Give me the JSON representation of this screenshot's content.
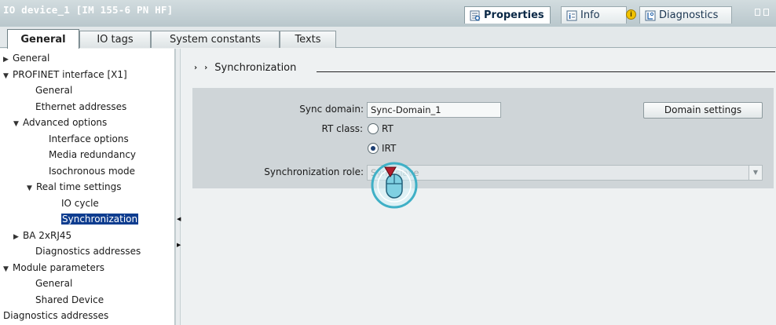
{
  "window": {
    "title": "IO device_1 [IM 155-6 PN HF]",
    "tabs": [
      {
        "label": "Properties",
        "icon": "properties-icon",
        "active": true
      },
      {
        "label": "Info",
        "icon": "info-icon",
        "active": false
      },
      {
        "label": "Diagnostics",
        "icon": "diagnostics-icon",
        "active": false
      }
    ]
  },
  "subtabs": [
    {
      "label": "General",
      "active": true
    },
    {
      "label": "IO tags",
      "active": false
    },
    {
      "label": "System constants",
      "active": false
    },
    {
      "label": "Texts",
      "active": false
    }
  ],
  "tree": [
    {
      "label": "General",
      "level": 0,
      "arrow": "right"
    },
    {
      "label": "PROFINET interface [X1]",
      "level": 0,
      "arrow": "down"
    },
    {
      "label": "General",
      "level": 2,
      "arrow": ""
    },
    {
      "label": "Ethernet addresses",
      "level": 2,
      "arrow": ""
    },
    {
      "label": "Advanced options",
      "level": 1,
      "arrow": "down"
    },
    {
      "label": "Interface options",
      "level": 3,
      "arrow": ""
    },
    {
      "label": "Media redundancy",
      "level": 3,
      "arrow": ""
    },
    {
      "label": "Isochronous mode",
      "level": 3,
      "arrow": ""
    },
    {
      "label": "Real time settings",
      "level": 2,
      "arrow": "down"
    },
    {
      "label": "IO cycle",
      "level": 4,
      "arrow": ""
    },
    {
      "label": "Synchronization",
      "level": 4,
      "arrow": "",
      "selected": true
    },
    {
      "label": "BA 2xRJ45",
      "level": 1,
      "arrow": "right"
    },
    {
      "label": "Diagnostics addresses",
      "level": 2,
      "arrow": ""
    },
    {
      "label": "Module parameters",
      "level": 0,
      "arrow": "down"
    },
    {
      "label": "General",
      "level": 2,
      "arrow": ""
    },
    {
      "label": "Shared Device",
      "level": 2,
      "arrow": ""
    },
    {
      "label": "Diagnostics addresses",
      "level": 0,
      "arrow": ""
    }
  ],
  "section": {
    "title": "Synchronization",
    "sync_domain_label": "Sync domain:",
    "sync_domain_value": "Sync-Domain_1",
    "domain_settings_button": "Domain settings",
    "rt_class_label": "RT class:",
    "rt_option": "RT",
    "irt_option": "IRT",
    "rt_class_selected": "IRT",
    "sync_role_label": "Synchronization role:",
    "sync_role_value": "Sync slave"
  },
  "colors": {
    "selection": "#0f3d8f",
    "cursor_ring": "#3fb0c6",
    "cursor_arrow": "#b01c2c"
  }
}
